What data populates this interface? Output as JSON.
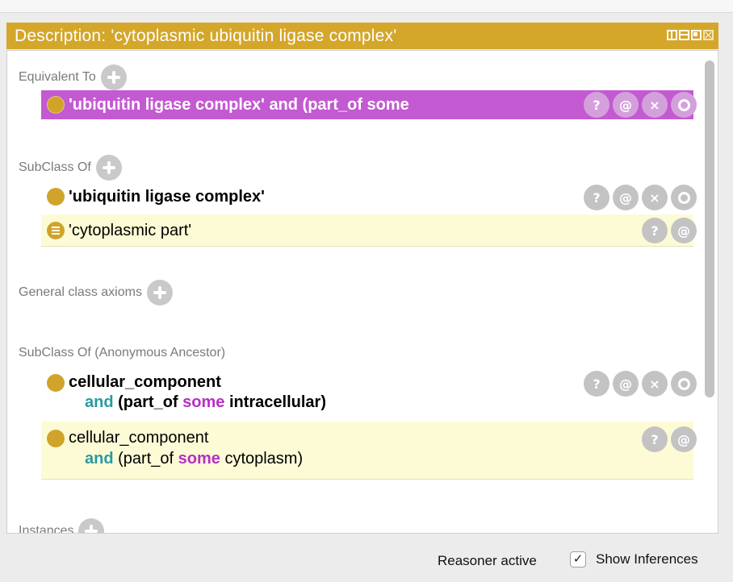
{
  "title": "Description: 'cytoplasmic ubiquitin ligase complex'",
  "sections": {
    "equivalent_to": "Equivalent To",
    "subclass_of": "SubClass Of",
    "general_axioms": "General class axioms",
    "anonymous_ancestor": "SubClass Of (Anonymous Ancestor)",
    "instances": "Instances"
  },
  "equivalent_row": {
    "text": "'ubiquitin ligase complex' and (part_of some"
  },
  "subclass_rows": [
    {
      "text": "'ubiquitin ligase complex'"
    },
    {
      "text": "'cytoplasmic part'"
    }
  ],
  "ancestor_rows": [
    {
      "line1": "cellular_component",
      "kw_and": "and",
      "pre": "(part_of",
      "kw_some": "some",
      "post": "intracellular)"
    },
    {
      "line1": "cellular_component",
      "kw_and": "and",
      "pre": "(part_of",
      "kw_some": "some",
      "post": "cytoplasm)"
    }
  ],
  "buttons": {
    "help": "?",
    "annotate": "@",
    "delete": "×"
  },
  "status": {
    "reasoner": "Reasoner active",
    "show_inferences": "Show Inferences",
    "checkmark": "✓"
  },
  "colors": {
    "title_bar": "#d4a62a",
    "selected_row": "#c35ad1",
    "inferred_row": "#fdfbd6",
    "class_dot": "#d0a42b",
    "keyword_and": "#2a9aa3",
    "keyword_some": "#b52fc3"
  },
  "icons": [
    "add-icon",
    "help-icon",
    "annotation-icon",
    "delete-icon",
    "explain-icon",
    "class-icon",
    "inferred-class-icon"
  ]
}
